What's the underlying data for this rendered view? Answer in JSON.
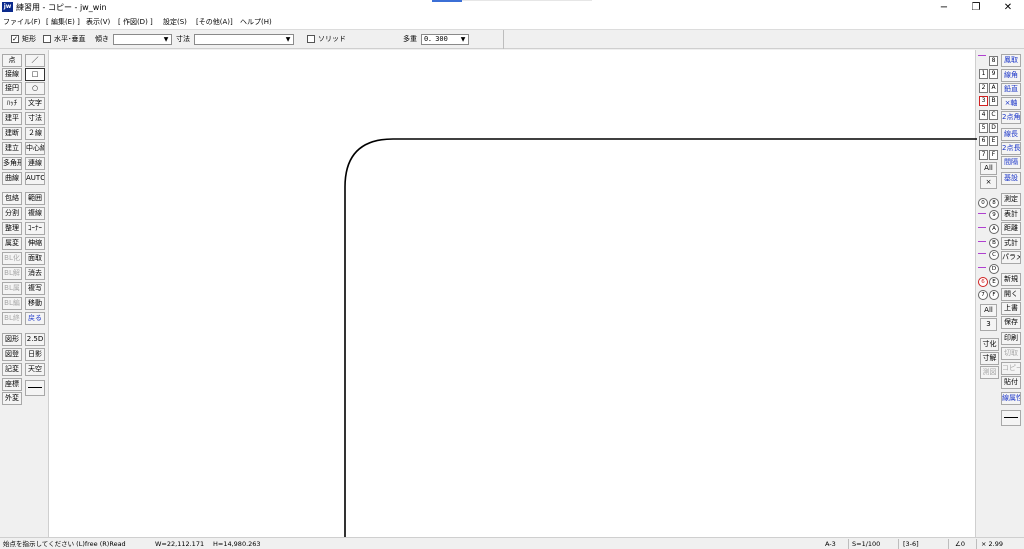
{
  "window": {
    "app_icon": "jw",
    "title": "練習用 - コピー - jw_win",
    "minimize": "−",
    "maximize": "❐",
    "close": "✕"
  },
  "menu": [
    "ファイル(F)",
    "[ 編集(E) ]",
    "表示(V)",
    "[ 作図(D) ]",
    "設定(S)",
    "[その他(A)]",
    "ヘルプ(H)"
  ],
  "options": {
    "rect_checked": true,
    "rect_label": "矩形",
    "hv_label": "水平･垂直",
    "angle_label": "傾き",
    "angle_value": "",
    "dim_label": "寸法",
    "dim_value": "",
    "solid_label": "ソリッド",
    "multi_label": "多重",
    "multi_value": "0．300"
  },
  "left_tools": [
    [
      "点",
      "／"
    ],
    [
      "接線",
      "□"
    ],
    [
      "接円",
      "○"
    ],
    [
      "ﾊｯﾁ",
      "文字"
    ],
    [
      "建平",
      "寸法"
    ],
    [
      "建断",
      "２線"
    ],
    [
      "建立",
      "中心線"
    ],
    [
      "多角形",
      "連線"
    ],
    [
      "曲線",
      "AUTO"
    ],
    [
      "包絡",
      "範囲"
    ],
    [
      "分割",
      "複線"
    ],
    [
      "整理",
      "ｺｰﾅｰ"
    ],
    [
      "属変",
      "伸縮"
    ],
    [
      "BL化",
      "面取"
    ],
    [
      "BL解",
      "消去"
    ],
    [
      "BL属",
      "複写"
    ],
    [
      "BL編",
      "移動"
    ],
    [
      "BL終",
      "戻る"
    ],
    [
      "図形",
      "2.5D"
    ],
    [
      "図登",
      "日影"
    ],
    [
      "記変",
      "天空"
    ],
    [
      "座標",
      ""
    ],
    [
      "外変",
      ""
    ]
  ],
  "layer_groups": [
    "0",
    "1",
    "2",
    "3",
    "4",
    "5",
    "6",
    "7"
  ],
  "layers": [
    "8",
    "9",
    "A",
    "B",
    "C",
    "D",
    "E",
    "F"
  ],
  "layer_all": "All",
  "layer_cross": "×",
  "layer_circles_left": [
    "0",
    "",
    "",
    "",
    "",
    "",
    "6",
    "7"
  ],
  "layer_circles_right": [
    "8",
    "9",
    "A",
    "B",
    "C",
    "D",
    "E",
    "F"
  ],
  "layer_all2": "All",
  "layer_num": "3",
  "dim_tools": [
    "寸化",
    "寸解",
    "測図"
  ],
  "right_tools": [
    "鳳取",
    "線角",
    "鉛直",
    "×軸",
    "2点角",
    "線長",
    "2点長",
    "間隔",
    "基設",
    "測定",
    "表計",
    "距離",
    "式計",
    "パラメ",
    "新規",
    "開く",
    "上書",
    "保存",
    "印刷",
    "切取",
    "コピー",
    "貼付",
    "線属性"
  ],
  "status": {
    "message": "始点を指示してください (L)free (R)Read",
    "width": "W=22,112.171",
    "height": "H=14,980.263",
    "paper": "A-3",
    "scale": "S=1/100",
    "layer": "[3-6]",
    "angle": "∠0",
    "zoom": "× 2.99"
  },
  "drawing": {
    "line_color": "#000000"
  }
}
